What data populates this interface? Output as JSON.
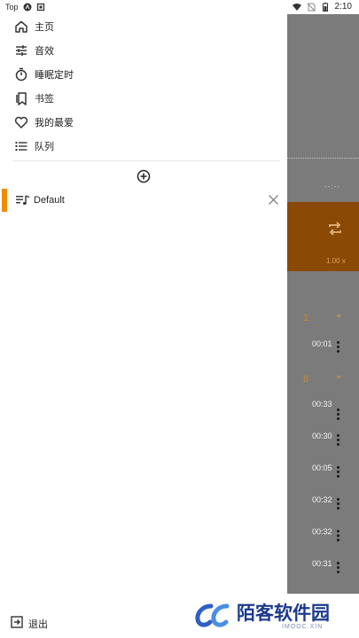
{
  "status_bar": {
    "carrier": "Top",
    "time": "2:10"
  },
  "drawer": {
    "menu": [
      {
        "label": "主页",
        "icon": "home-icon"
      },
      {
        "label": "音效",
        "icon": "equalizer-icon"
      },
      {
        "label": "睡眠定时",
        "icon": "timer-icon"
      },
      {
        "label": "书签",
        "icon": "bookmark-icon"
      },
      {
        "label": "我的最爱",
        "icon": "heart-icon"
      },
      {
        "label": "队列",
        "icon": "queue-icon"
      }
    ],
    "playlist": {
      "label": "Default",
      "accent": "#f08a00"
    },
    "logout_label": "退出"
  },
  "background_player": {
    "time_placeholder": "--:--",
    "speed": "1.00 x",
    "groups": [
      {
        "number": "1",
        "items": [
          "00:01"
        ]
      },
      {
        "number": "8",
        "items": [
          "00:33",
          "00:30",
          "00:05",
          "00:32",
          "00:32",
          "00:31"
        ]
      }
    ],
    "colors": {
      "panel": "#7b7b7b",
      "accent": "#8a4a06"
    }
  },
  "watermark": {
    "text": "陌客软件园",
    "sub": "IMOOC.XIN"
  }
}
